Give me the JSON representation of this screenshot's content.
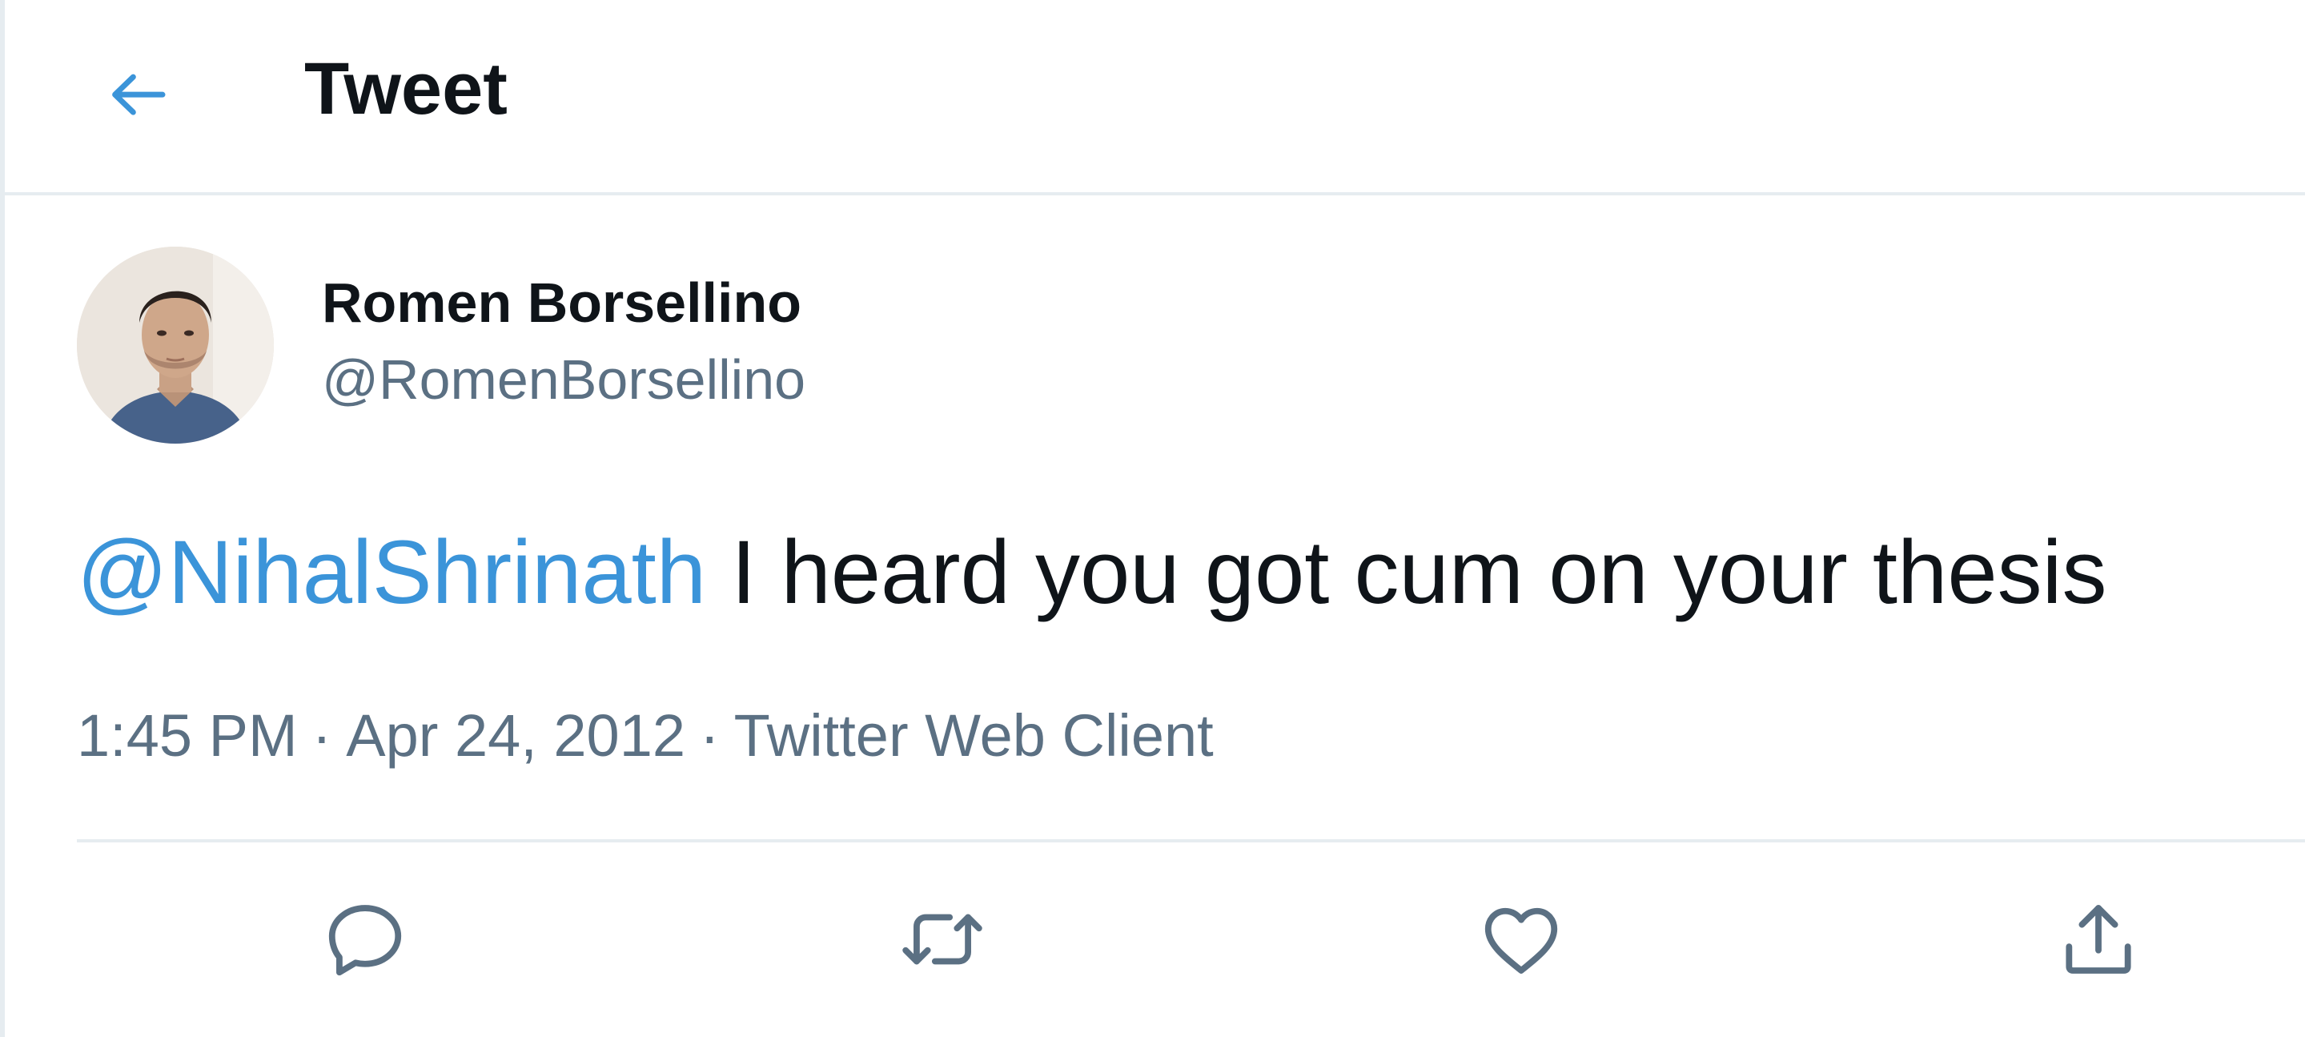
{
  "header": {
    "title": "Tweet",
    "back_icon": "arrow-left-icon"
  },
  "author": {
    "display_name": "Romen Borsellino",
    "handle": "@RomenBorsellino",
    "avatar_icon": "user-avatar-photo"
  },
  "tweet": {
    "mention": "@NihalShrinath",
    "text": "I heard you got cum on your thesis"
  },
  "meta": {
    "time": "1:45 PM",
    "separator": "·",
    "date": "Apr 24, 2012",
    "source": "Twitter Web Client"
  },
  "actions": [
    {
      "name": "reply",
      "icon": "reply-icon"
    },
    {
      "name": "retweet",
      "icon": "retweet-icon"
    },
    {
      "name": "like",
      "icon": "heart-icon"
    },
    {
      "name": "share",
      "icon": "share-icon"
    }
  ],
  "colors": {
    "accent": "#3b94d9",
    "text_primary": "#0f1419",
    "text_secondary": "#5b7083",
    "divider": "#e6ecf0",
    "background": "#ffffff"
  }
}
